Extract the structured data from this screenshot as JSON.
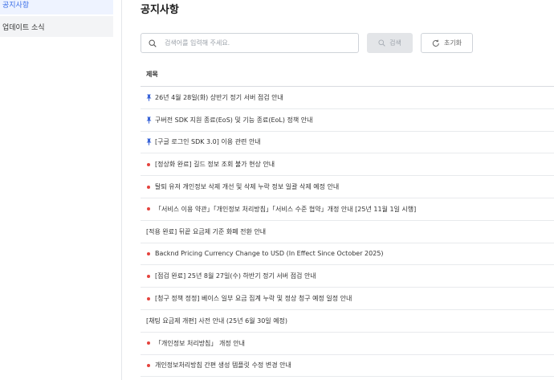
{
  "sidebar": {
    "items": [
      {
        "label": "공지사항"
      },
      {
        "label": "업데이트 소식"
      }
    ]
  },
  "main": {
    "title": "공지사항",
    "search": {
      "placeholder": "검색어를 입력해 주세요.",
      "value": ""
    },
    "buttons": {
      "search": "검색",
      "reset": "초기화"
    },
    "table": {
      "header": "제목",
      "rows": [
        {
          "mark": "pin",
          "title": "26년 4월 28일(화) 상반기 정기 서버 점검 안내"
        },
        {
          "mark": "pin",
          "title": "구버전 SDK 지원 종료(EoS) 및 기능 종료(EoL) 정책 안내"
        },
        {
          "mark": "pin",
          "title": "[구글 로그인 SDK 3.0] 이용 관련 안내"
        },
        {
          "mark": "dot",
          "title": "[정상화 완료] 길드 정보 조회 불가 현상 안내"
        },
        {
          "mark": "dot",
          "title": "탈퇴 유저 개인정보 삭제 개선 및 삭제 누락 정보 일괄 삭제 예정 안내"
        },
        {
          "mark": "dot",
          "title": "「서비스 이용 약관」「개인정보 처리방침」「서비스 수준 협약」개정 안내 [25년 11월 1일 시행]"
        },
        {
          "mark": "none",
          "title": "[적용 완료] 뒤끝 요금제 기준 화폐 전환 안내"
        },
        {
          "mark": "dot",
          "title": "Backnd Pricing Currency Change to USD (In Effect Since October 2025)"
        },
        {
          "mark": "dot",
          "title": "[점검 완료] 25년 8월 27일(수) 하반기 정기 서버 점검 안내"
        },
        {
          "mark": "dot",
          "title": "[청구 정책 정정] 베이스 일부 요금 집계 누락 및 정상 청구 예정 일정 안내"
        },
        {
          "mark": "none",
          "title": "[채팅 요금제 개편] 사전 안내 (25년 6월 30일 예정)"
        },
        {
          "mark": "dot",
          "title": "「개인정보 처리방침」 개정 안내"
        },
        {
          "mark": "dot",
          "title": "개인정보처리방침 간편 생성 템플릿 수정 변경 안내"
        }
      ]
    }
  },
  "colors": {
    "accent": "#3b6fe8",
    "pin": "#3a64d8",
    "new_dot": "#e5433d"
  },
  "icons": {
    "search": "search-icon",
    "reset": "refresh-icon",
    "pin": "pin-icon",
    "dot": "new-dot-icon"
  }
}
